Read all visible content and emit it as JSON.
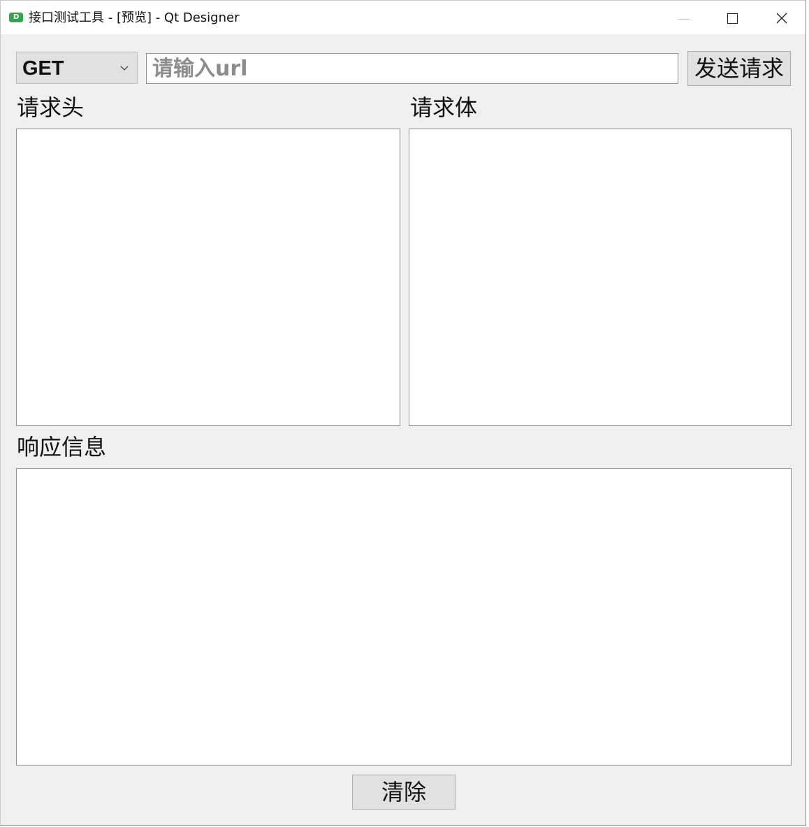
{
  "window": {
    "title": "接口测试工具 - [预览] - Qt Designer",
    "app_icon_letter": "D"
  },
  "request": {
    "method": "GET",
    "url_placeholder": "请输入url",
    "url_value": "",
    "send_label": "发送请求"
  },
  "sections": {
    "headers_label": "请求头",
    "body_label": "请求体",
    "response_label": "响应信息"
  },
  "fields": {
    "headers_value": "",
    "body_value": "",
    "response_value": ""
  },
  "actions": {
    "clear_label": "清除"
  }
}
